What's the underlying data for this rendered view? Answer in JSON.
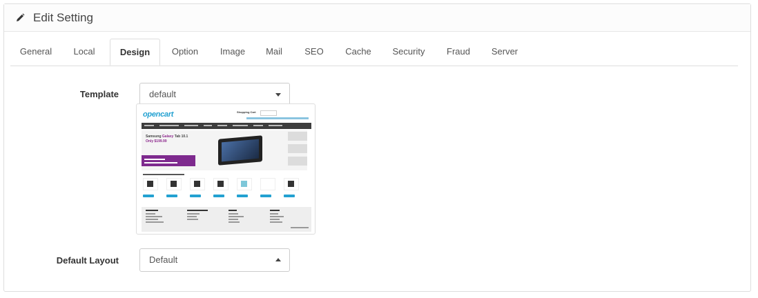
{
  "header": {
    "title": "Edit Setting",
    "icon": "pencil-icon"
  },
  "tabs": [
    {
      "label": "General"
    },
    {
      "label": "Local"
    },
    {
      "label": "Design",
      "active": true
    },
    {
      "label": "Option"
    },
    {
      "label": "Image"
    },
    {
      "label": "Mail"
    },
    {
      "label": "SEO"
    },
    {
      "label": "Cache"
    },
    {
      "label": "Security"
    },
    {
      "label": "Fraud"
    },
    {
      "label": "Server"
    }
  ],
  "form": {
    "template": {
      "label": "Template",
      "value": "default"
    },
    "default_layout": {
      "label": "Default Layout",
      "value": "Default"
    }
  },
  "preview": {
    "logo": "opencart",
    "cart": "Shopping Cart",
    "banner_title_a": "Samsung ",
    "banner_title_b": "Galaxy",
    "banner_title_c": " Tab 10.1",
    "banner_price": "Only $199.99"
  },
  "colors": {
    "accent": "#23a1d1",
    "purple": "#7e2a8e",
    "menu": "#3d3d3d"
  }
}
